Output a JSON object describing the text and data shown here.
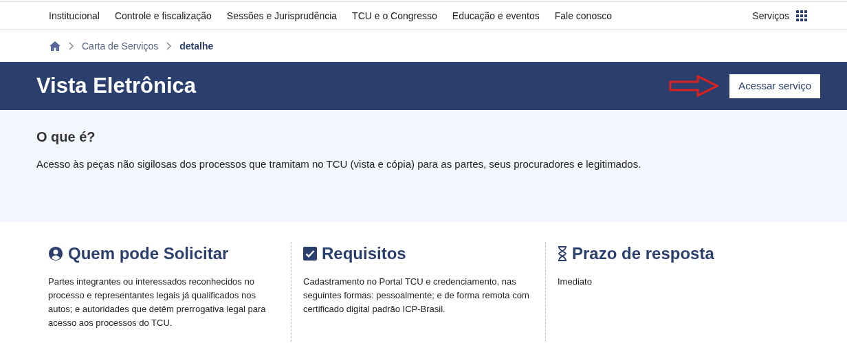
{
  "nav": {
    "items": [
      "Institucional",
      "Controle e fiscalização",
      "Sessões e Jurisprudência",
      "TCU e o Congresso",
      "Educação e eventos",
      "Fale conosco"
    ],
    "services": "Serviços"
  },
  "breadcrumb": [
    "Carta de Serviços",
    "detalhe"
  ],
  "banner": {
    "title": "Vista Eletrônica",
    "button": "Acessar serviço"
  },
  "intro": {
    "heading": "O que é?",
    "text": "Acesso às peças não sigilosas dos processos que tramitam no TCU (vista e cópia) para as partes, seus procuradores e legitimados."
  },
  "cards": [
    {
      "kind": "person",
      "title": "Quem pode Solicitar",
      "text": "Partes integrantes ou interessados reconhecidos no processo e representantes legais já qualificados nos autos; e autoridades que detêm prerrogativa legal para acesso aos processos do TCU."
    },
    {
      "kind": "check",
      "title": "Requisitos",
      "text": "Cadastramento no Portal TCU e credenciamento, nas seguintes formas: pessoalmente; e de forma remota com certificado digital padrão ICP-Brasil."
    },
    {
      "kind": "hourglass",
      "title": "Prazo de resposta",
      "text": "Imediato"
    }
  ]
}
